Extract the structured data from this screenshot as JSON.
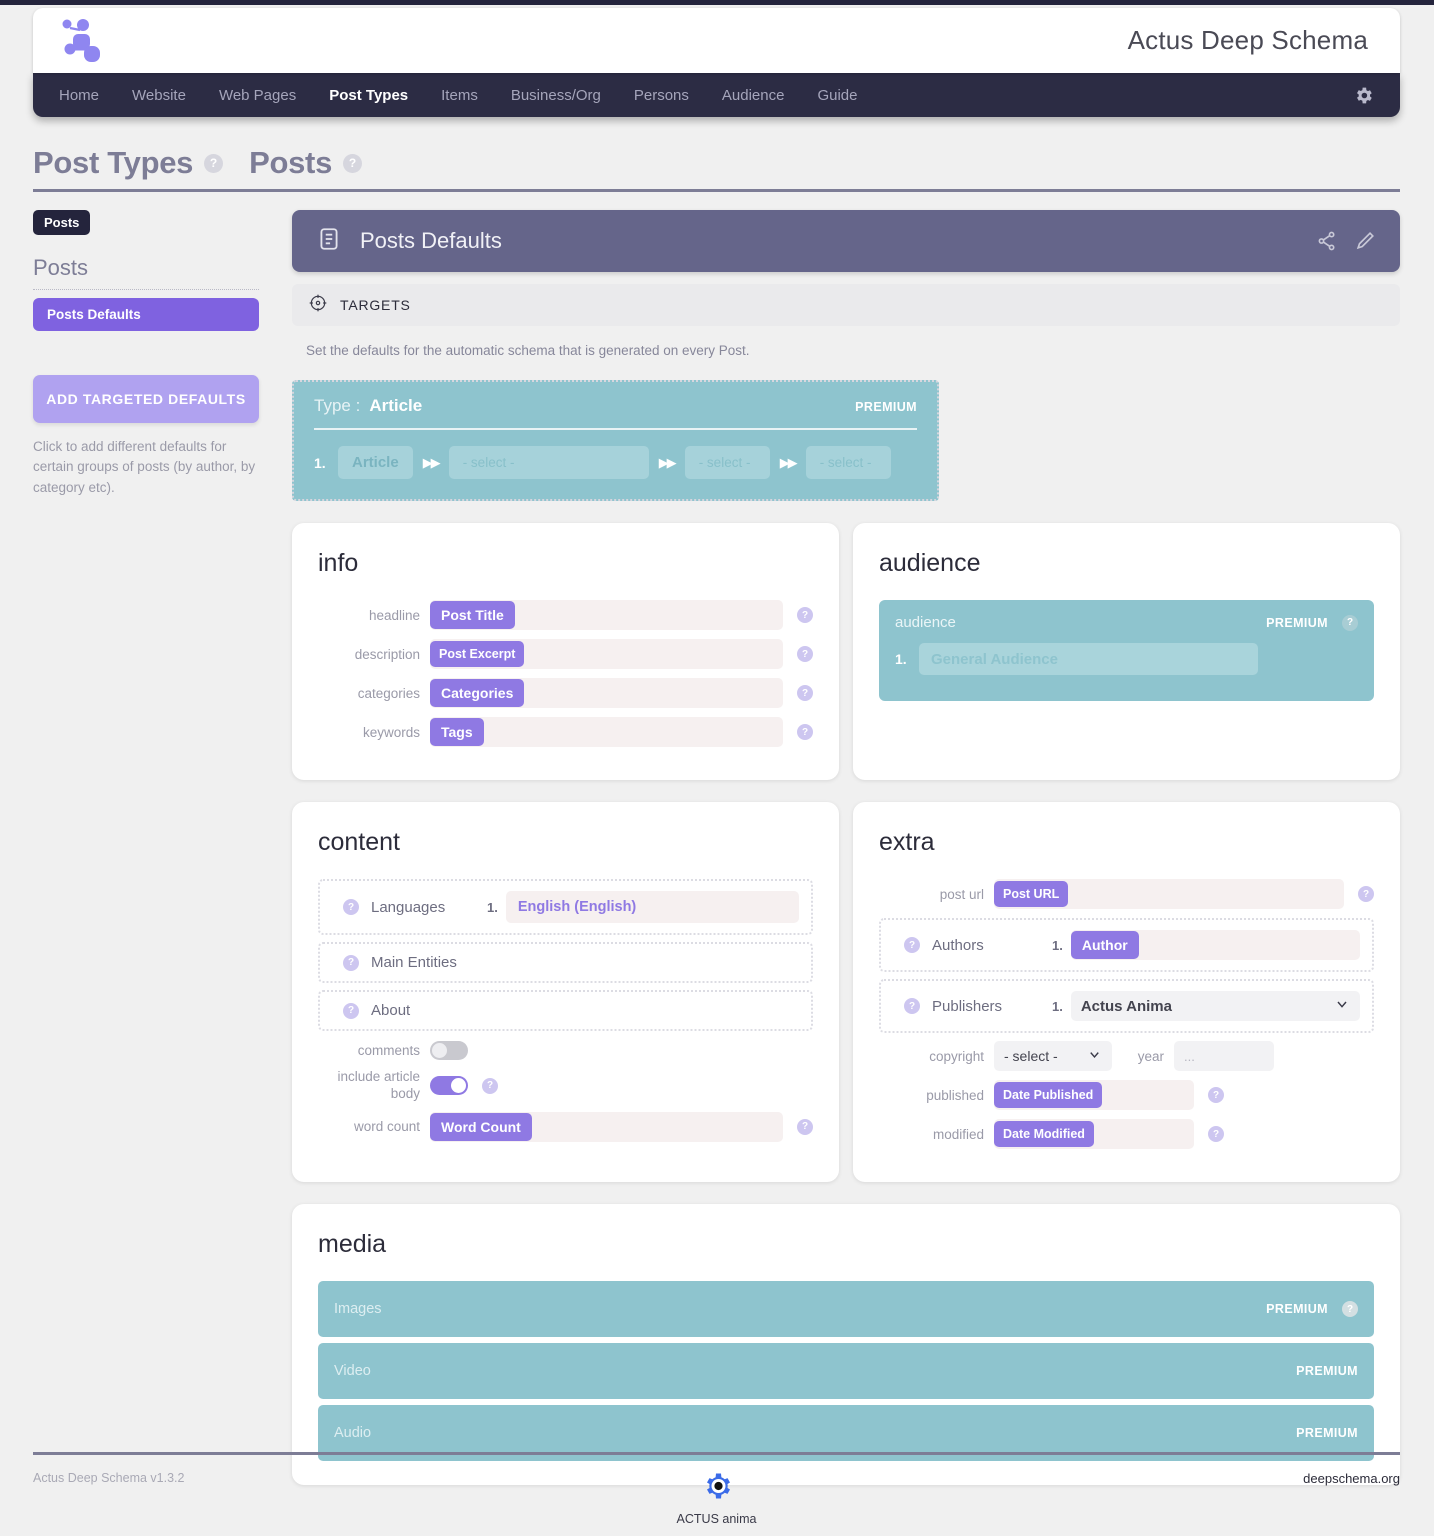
{
  "app": {
    "title": "Actus Deep Schema",
    "logo_icon": "schema-node-logo"
  },
  "nav": {
    "items": [
      {
        "label": "Home",
        "active": false
      },
      {
        "label": "Website",
        "active": false
      },
      {
        "label": "Web Pages",
        "active": false
      },
      {
        "label": "Post Types",
        "active": true
      },
      {
        "label": "Items",
        "active": false
      },
      {
        "label": "Business/Org",
        "active": false
      },
      {
        "label": "Persons",
        "active": false
      },
      {
        "label": "Audience",
        "active": false
      },
      {
        "label": "Guide",
        "active": false
      }
    ],
    "settings_icon": "gear-icon"
  },
  "page": {
    "title_primary": "Post Types",
    "title_secondary": "Posts",
    "help_glyph": "?"
  },
  "sidebar": {
    "tag": "Posts",
    "group_title": "Posts",
    "items": [
      {
        "label": "Posts Defaults",
        "active": true
      }
    ],
    "add_button": "ADD TARGETED DEFAULTS",
    "add_help": "Click to add different defaults for certain groups of posts (by author, by category etc)."
  },
  "panel": {
    "icon": "document-lines-icon",
    "title": "Posts Defaults",
    "actions": [
      {
        "icon": "share-nodes-icon"
      },
      {
        "icon": "pencil-edit-icon"
      }
    ],
    "targets_label": "TARGETS",
    "targets_icon": "crosshair-target-icon",
    "description": "Set the defaults for the automatic schema that is generated on every Post."
  },
  "type_panel": {
    "label": "Type :",
    "value": "Article",
    "badge": "PREMIUM",
    "row_number": "1.",
    "chip": "Article",
    "arrow": "▶▶",
    "selects": [
      {
        "value": "- select -"
      },
      {
        "value": "- select -"
      },
      {
        "value": "- select -"
      }
    ]
  },
  "info_card": {
    "title": "info",
    "rows": [
      {
        "label": "headline",
        "token": "Post Title",
        "help": "?"
      },
      {
        "label": "description",
        "token": "Post Excerpt",
        "help": "?"
      },
      {
        "label": "categories",
        "token": "Categories",
        "help": "?"
      },
      {
        "label": "keywords",
        "token": "Tags",
        "help": "?"
      }
    ]
  },
  "audience_card": {
    "title": "audience",
    "block_label": "audience",
    "badge": "PREMIUM",
    "help": "?",
    "row_number": "1.",
    "value": "General Audience"
  },
  "content_card": {
    "title": "content",
    "languages": {
      "label": "Languages",
      "help": "?",
      "row_number": "1.",
      "value": "English (English)"
    },
    "main_entities": {
      "label": "Main Entities",
      "help": "?"
    },
    "about": {
      "label": "About",
      "help": "?"
    },
    "comments": {
      "label": "comments",
      "on": false
    },
    "include_article_body": {
      "label": "include article body",
      "on": true,
      "help": "?"
    },
    "word_count": {
      "label": "word count",
      "token": "Word Count",
      "help": "?"
    }
  },
  "extra_card": {
    "title": "extra",
    "post_url": {
      "label": "post url",
      "token": "Post URL",
      "help": "?"
    },
    "authors": {
      "label": "Authors",
      "help": "?",
      "row_number": "1.",
      "token": "Author"
    },
    "publishers": {
      "label": "Publishers",
      "help": "?",
      "row_number": "1.",
      "value": "Actus Anima",
      "chevron": "⌄"
    },
    "copyright": {
      "label": "copyright",
      "value": "- select -",
      "chevron": "⌄"
    },
    "year": {
      "label": "year",
      "placeholder": "..."
    },
    "published": {
      "label": "published",
      "token": "Date Published",
      "help": "?"
    },
    "modified": {
      "label": "modified",
      "token": "Date Modified",
      "help": "?"
    }
  },
  "media_card": {
    "title": "media",
    "rows": [
      {
        "label": "Images",
        "badge": "PREMIUM",
        "help": "?"
      },
      {
        "label": "Video",
        "badge": "PREMIUM",
        "help": ""
      },
      {
        "label": "Audio",
        "badge": "PREMIUM",
        "help": ""
      }
    ]
  },
  "footer": {
    "version": "Actus Deep Schema v1.3.2",
    "brand": "ACTUS anima",
    "brand_icon": "gear-dot-icon",
    "site": "deepschema.org"
  },
  "colors": {
    "accent_purple": "#7f62e0",
    "token_purple": "#8f79e3",
    "lilac": "#b0a2f0",
    "teal": "#8ec4ce",
    "nav_dark": "#2c2c44",
    "panel_slate": "#65658a",
    "muted": "#9a9aa8"
  }
}
